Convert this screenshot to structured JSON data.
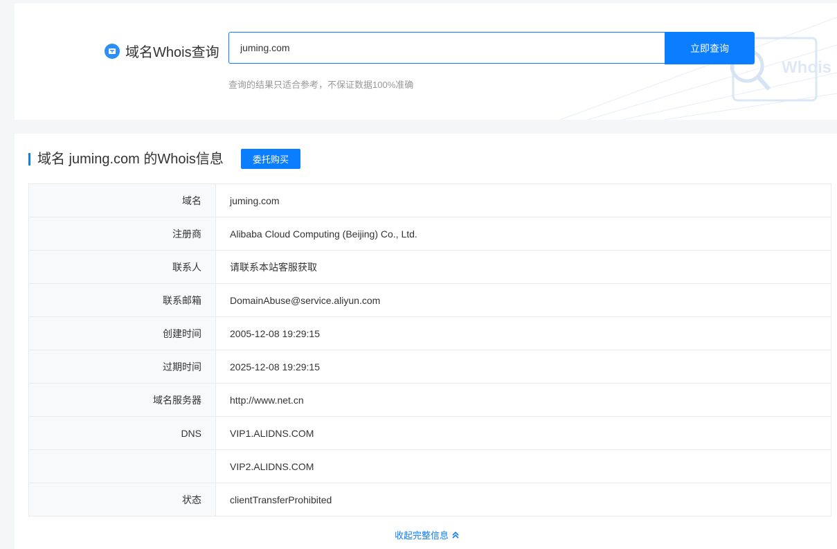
{
  "search": {
    "title": "域名Whois查询",
    "value": "juming.com",
    "button_label": "立即查询",
    "hint": "查询的结果只适合参考，不保证数据100%准确"
  },
  "result": {
    "title": "域名 juming.com 的Whois信息",
    "delegate_button": "委托购买",
    "rows": [
      {
        "label": "域名",
        "value": "juming.com"
      },
      {
        "label": "注册商",
        "value": "Alibaba Cloud Computing (Beijing) Co., Ltd."
      },
      {
        "label": "联系人",
        "value": "请联系本站客服获取"
      },
      {
        "label": "联系邮箱",
        "value": "DomainAbuse@service.aliyun.com"
      },
      {
        "label": "创建时间",
        "value": "2005-12-08 19:29:15"
      },
      {
        "label": "过期时间",
        "value": "2025-12-08 19:29:15"
      },
      {
        "label": "域名服务器",
        "value": "http://www.net.cn"
      },
      {
        "label": "DNS",
        "value": "VIP1.ALIDNS.COM"
      },
      {
        "label": "",
        "value": "VIP2.ALIDNS.COM"
      },
      {
        "label": "状态",
        "value": "clientTransferProhibited"
      }
    ],
    "collapse_label": "收起完整信息"
  },
  "decoration": {
    "watermark_text": "Whois"
  },
  "colors": {
    "accent": "#0b7dff",
    "background": "#f5f6f8"
  }
}
